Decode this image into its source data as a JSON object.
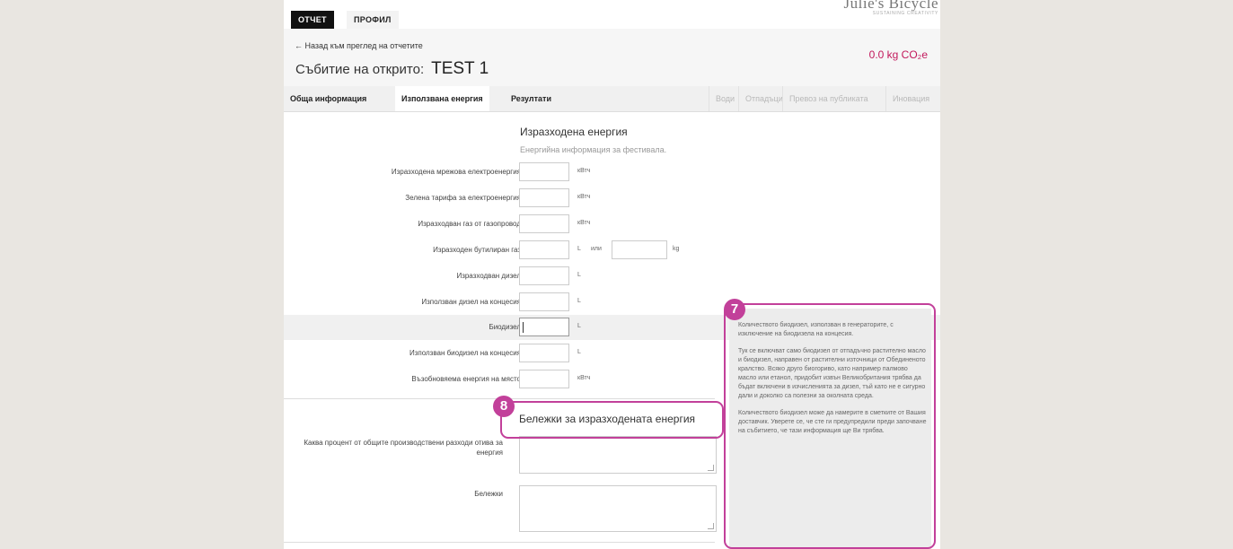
{
  "topbar": {
    "tab_report": "ОТЧЕТ",
    "tab_profile": "ПРОФИЛ",
    "brand_name": "Julie's Bicycle",
    "brand_sub": "SUSTAINING CREATIVITY"
  },
  "header": {
    "back_link": "← Назад към преглед на отчетите",
    "event_label": "Събитие на открито:",
    "event_name": "TEST 1",
    "co2": "0.0 kg CO₂e"
  },
  "tabs": [
    {
      "label": "Обща информация",
      "state": "normal"
    },
    {
      "label": "Използвана енергия",
      "state": "active"
    },
    {
      "label": "Резултати",
      "state": "normal"
    },
    {
      "label": "Води",
      "state": "disabled"
    },
    {
      "label": "Отпадъци",
      "state": "disabled"
    },
    {
      "label": "Превоз на публиката",
      "state": "disabled"
    },
    {
      "label": "Иновация",
      "state": "disabled"
    }
  ],
  "section": {
    "title": "Изразходена енергия",
    "subtitle": "Енергийна информация за фестивала."
  },
  "energy_rows": [
    {
      "label": "Изразходена мрежова електроенергия",
      "value": "",
      "unit": "кВтч"
    },
    {
      "label": "Зелена тарифа за електроенергия",
      "value": "",
      "unit": "кВтч"
    },
    {
      "label": "Изразходван газ от газопровод",
      "value": "",
      "unit": "кВтч"
    },
    {
      "label": "Изразходен бутилиран газ",
      "value": "",
      "unit": "L",
      "or": "или",
      "unit2": "kg"
    },
    {
      "label": "Изразходван дизел",
      "value": "",
      "unit": "L"
    },
    {
      "label": "Използван дизел на концесия",
      "value": "",
      "unit": "L"
    },
    {
      "label": "Биодизел",
      "value": "",
      "unit": "L"
    },
    {
      "label": "Използван биодизел на концесия",
      "value": "",
      "unit": "L"
    },
    {
      "label": "Възобновяема енергия на място",
      "value": "",
      "unit": "кВтч"
    }
  ],
  "notes": {
    "title": "Бележки за изразходената енергия",
    "percent_label": "Каква процент от общите производствени разходи отива за енергия",
    "notes_label": "Бележки"
  },
  "help": {
    "paragraphs": [
      "Количеството биодизел, използван в генераторите, с изключение на биодизела на концесия.",
      "Тук се включват само биодизел от отпадъчно растително масло и биодизел, направен от растителни източници от Обединеното кралство. Всяко друго биогориво, като например палмово масло или етанол, придобит извън Великобритания трябва да бъдат включени в изчисленията за дизел, тъй като не е сигурно дали и доколко са полезни за околната среда.",
      "Количеството биодизел може да намерите в сметките от Вашия доставчик. Уверете се, че сте ги предупредили преди започване на събитието, че тази информация ще Ви трябва."
    ]
  },
  "callouts": {
    "help_badge": "7",
    "notes_badge": "8",
    "color": "#c2409a"
  }
}
